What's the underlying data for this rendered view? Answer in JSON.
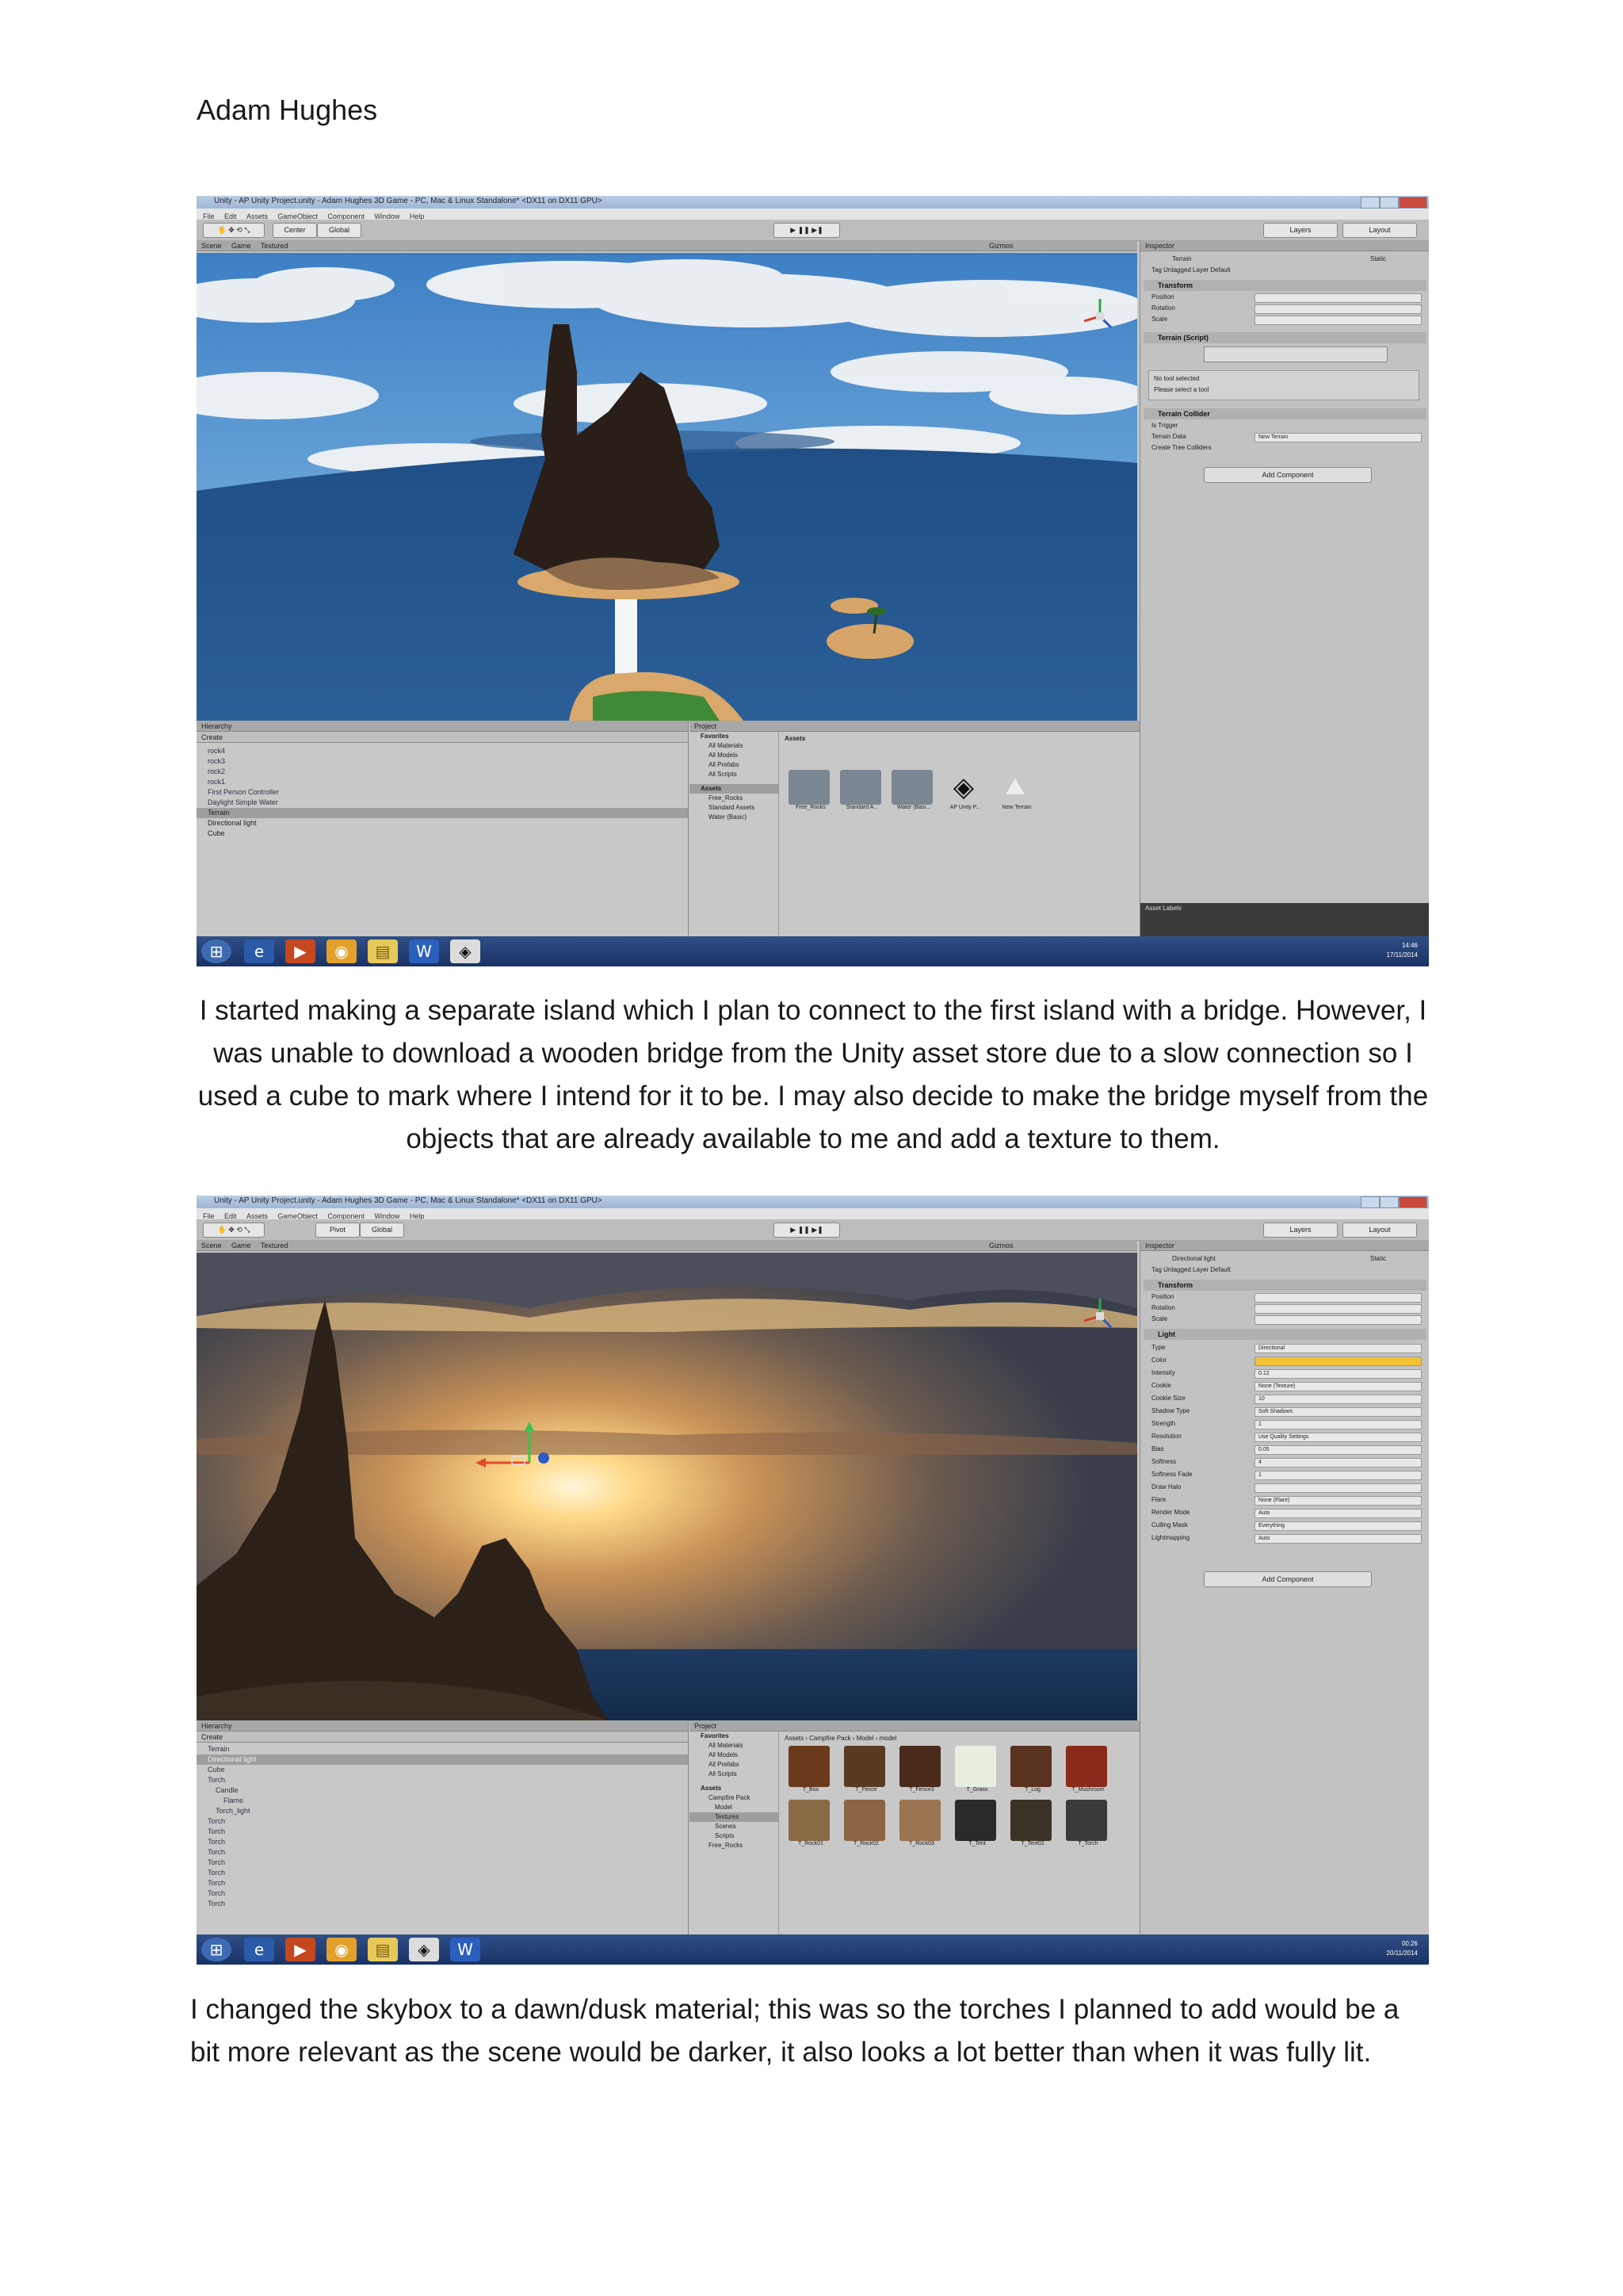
{
  "author": "Adam Hughes",
  "paragraphs": [
    "I started making a separate island which I plan to connect to the first island with a bridge. However, I was unable to download a wooden bridge from the Unity asset store due to a slow connection so I used a cube to mark where I intend for it to be. I may also decide to make the bridge myself from the objects that are already available to me and add a texture to them.",
    "I changed the skybox to a dawn/dusk material; this was so the torches I planned to add would be a bit more relevant as the scene would be darker, it also looks a lot better than when it was fully lit."
  ],
  "screenshots": [
    {
      "title": "Unity - AP Unity Project.unity - Adam Hughes 3D Game - PC, Mac & Linux Standalone* <DX11 on DX11 GPU>",
      "menu": [
        "File",
        "Edit",
        "Assets",
        "GameObject",
        "Component",
        "Window",
        "Help"
      ],
      "pivot_buttons": [
        "Center",
        "Global"
      ],
      "tabs": {
        "scene": "Scene",
        "game": "Game",
        "shading": "Textured",
        "gizmos": "Gizmos",
        "layers": "Layers",
        "layout": "Layout"
      },
      "inspector": {
        "tab": "Inspector",
        "object_name": "Terrain",
        "static_label": "Static",
        "tag_row": "Tag  Untagged       Layer  Default",
        "sections": [
          "Transform",
          "Terrain (Script)",
          "Terrain Collider"
        ],
        "rows": [
          "Position",
          "Rotation",
          "Scale"
        ],
        "note_lines": [
          "No tool selected",
          "Please select a tool"
        ],
        "collider_rows": [
          "Is Trigger",
          "Terrain Data",
          "Create Tree Colliders"
        ],
        "terrain_data_value": "New Terrain",
        "add_component": "Add Component",
        "footer": "Asset Labels"
      },
      "hierarchy": {
        "tab": "Hierarchy",
        "create": "Create",
        "items": [
          "rock4",
          "rock3",
          "rock2",
          "rock1",
          "First Person Controller",
          "Daylight Simple Water",
          "Terrain",
          "Directional light",
          "Cube"
        ]
      },
      "project": {
        "tab": "Project",
        "create": "Create",
        "tree": [
          "Favorites",
          "All Materials",
          "All Models",
          "All Prefabs",
          "All Scripts",
          "Assets",
          "Free_Rocks",
          "Standard Assets",
          "Water (Basic)"
        ],
        "breadcrumb": "Assets",
        "assets": [
          "Free_Rocks",
          "Standard A...",
          "Water (Basi...",
          "AP Unity P...",
          "New Terrain"
        ]
      },
      "clock": {
        "time": "14:46",
        "date": "17/11/2014"
      }
    },
    {
      "title": "Unity - AP Unity Project.unity - Adam Hughes 3D Game - PC, Mac & Linux Standalone* <DX11 on DX11 GPU>",
      "menu": [
        "File",
        "Edit",
        "Assets",
        "GameObject",
        "Component",
        "Window",
        "Help"
      ],
      "pivot_buttons": [
        "Pivot",
        "Global"
      ],
      "tabs": {
        "scene": "Scene",
        "game": "Game",
        "shading": "Textured",
        "gizmos": "Gizmos",
        "layers": "Layers",
        "layout": "Layout"
      },
      "inspector": {
        "tab": "Inspector",
        "object_name": "Directional light",
        "static_label": "Static",
        "tag_row": "Tag  Untagged       Layer  Default",
        "sections": [
          "Transform",
          "Light"
        ],
        "rows": [
          "Position",
          "Rotation",
          "Scale"
        ],
        "light_rows": [
          "Type",
          "Color",
          "Intensity",
          "Cookie",
          "Cookie Size",
          "Shadow Type",
          "Strength",
          "Resolution",
          "Bias",
          "Softness",
          "Softness Fade",
          "Draw Halo",
          "Flare",
          "Render Mode",
          "Culling Mask",
          "Lightmapping"
        ],
        "light_values": [
          "Directional",
          "",
          "0.12",
          "None (Texture)",
          "10",
          "Soft Shadows",
          "1",
          "Use Quality Settings",
          "0.05",
          "4",
          "1",
          "",
          "None (Flare)",
          "Auto",
          "Everything",
          "Auto"
        ],
        "add_component": "Add Component"
      },
      "hierarchy": {
        "tab": "Hierarchy",
        "create": "Create",
        "items": [
          "Terrain",
          "Directional light",
          "Cube",
          "Torch",
          "Candle",
          "Flame",
          "Torch_light",
          "Torch",
          "Torch",
          "Torch",
          "Torch",
          "Torch",
          "Torch",
          "Torch",
          "Torch",
          "Torch"
        ]
      },
      "project": {
        "tab": "Project",
        "create": "Create",
        "tree": [
          "Favorites",
          "All Materials",
          "All Models",
          "All Prefabs",
          "All Scripts",
          "Assets",
          "Campfire Pack",
          "Model",
          "Textures",
          "Scenes",
          "Scripts",
          "Free_Rocks"
        ],
        "breadcrumb": "Assets › Campfire Pack › Model › model",
        "assets_top": [
          "T_Box",
          "T_Fence",
          "T_Fence3",
          "T_Grass",
          "T_Log",
          "T_Mushroom"
        ],
        "assets_bottom": [
          "T_Rock01",
          "T_Rock02",
          "T_Rock03",
          "T_Tent",
          "T_Tent02",
          "T_Torch"
        ]
      },
      "clock": {
        "time": "00:26",
        "date": "20/11/2014"
      }
    }
  ]
}
